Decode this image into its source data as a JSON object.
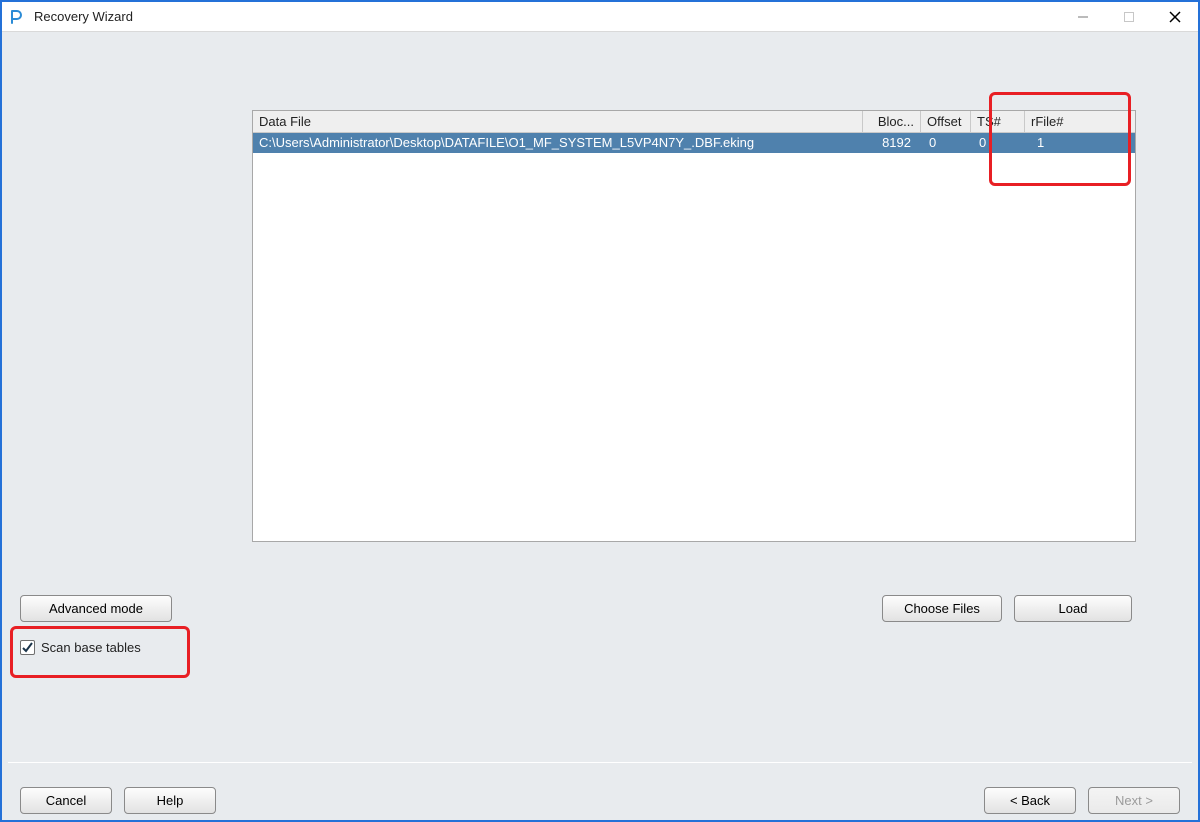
{
  "window": {
    "title": "Recovery Wizard"
  },
  "grid": {
    "columns": {
      "datafile": "Data File",
      "block": "Bloc...",
      "offset": "Offset",
      "ts": "TS#",
      "rfile": "rFile#"
    },
    "rows": [
      {
        "datafile": "C:\\Users\\Administrator\\Desktop\\DATAFILE\\O1_MF_SYSTEM_L5VP4N7Y_.DBF.eking",
        "block": "8192",
        "offset": "0",
        "ts": "0",
        "rfile": "1"
      }
    ]
  },
  "buttons": {
    "advanced": "Advanced mode",
    "choose": "Choose Files",
    "load": "Load",
    "cancel": "Cancel",
    "help": "Help",
    "back": "<  Back",
    "next": "Next  >"
  },
  "checkbox": {
    "scan_label": "Scan base tables",
    "scan_checked": true
  }
}
